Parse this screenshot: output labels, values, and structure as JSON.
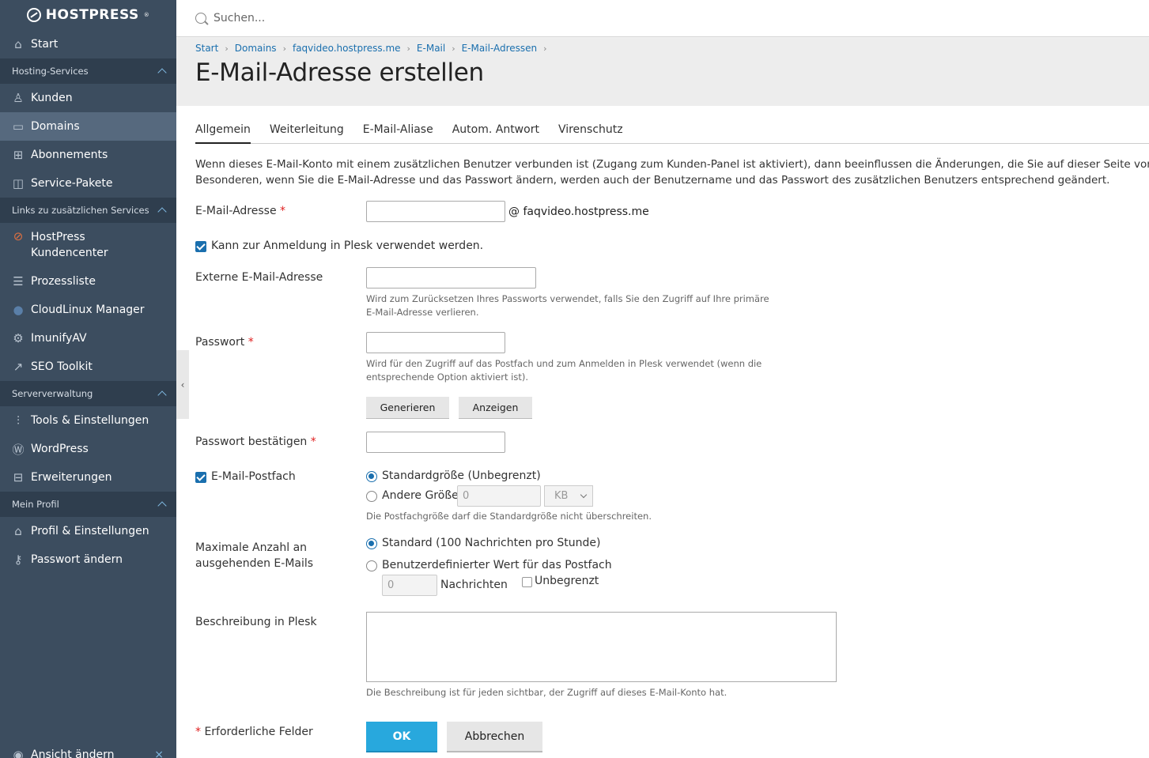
{
  "brand": {
    "name": "HOSTPRESS",
    "reg": "®"
  },
  "search": {
    "placeholder": "Suchen..."
  },
  "sidebar": {
    "start": "Start",
    "groups": {
      "hosting": "Hosting-Services",
      "links": "Links zu zusätzlichen Services",
      "server": "Serververwaltung",
      "profile": "Mein Profil"
    },
    "items": {
      "kunden": "Kunden",
      "domains": "Domains",
      "abonnements": "Abonnements",
      "service_pakete": "Service-Pakete",
      "hostpress_kc_1": "HostPress",
      "hostpress_kc_2": "Kundencenter",
      "prozessliste": "Prozessliste",
      "cloudlinux": "CloudLinux Manager",
      "imunify": "ImunifyAV",
      "seo": "SEO Toolkit",
      "tools": "Tools & Einstellungen",
      "wordpress": "WordPress",
      "erweiterungen": "Erweiterungen",
      "profil": "Profil & Einstellungen",
      "passwort": "Passwort ändern",
      "ansicht": "Ansicht ändern"
    }
  },
  "breadcrumb": [
    "Start",
    "Domains",
    "faqvideo.hostpress.me",
    "E-Mail",
    "E-Mail-Adressen"
  ],
  "page_title": "E-Mail-Adresse erstellen",
  "tabs": [
    "Allgemein",
    "Weiterleitung",
    "E-Mail-Aliase",
    "Autom. Antwort",
    "Virenschutz"
  ],
  "intro": {
    "line1": "Wenn dieses E-Mail-Konto mit einem zusätzlichen Benutzer verbunden ist (Zugang zum Kunden-Panel ist aktiviert), dann beeinflussen die Änderungen, die Sie auf dieser Seite vornehmen, a",
    "line2": "Besonderen, wenn Sie die E-Mail-Adresse und das Passwort ändern, werden auch der Benutzername und das Passwort des zusätzlichen Benutzers entsprechend geändert."
  },
  "form": {
    "email_label": "E-Mail-Adresse",
    "required_mark": "*",
    "email_domain": "@ faqvideo.hostpress.me",
    "login_checkbox": "Kann zur Anmeldung in Plesk verwendet werden.",
    "external_label": "Externe E-Mail-Adresse",
    "external_hint_1": "Wird zum Zurücksetzen Ihres Passworts verwendet, falls Sie den Zugriff auf Ihre primäre",
    "external_hint_2": "E-Mail-Adresse verlieren.",
    "password_label": "Passwort",
    "password_hint_1": "Wird für den Zugriff auf das Postfach und zum Anmelden in Plesk verwendet (wenn die",
    "password_hint_2": "entsprechende Option aktiviert ist).",
    "generate_btn": "Generieren",
    "show_btn": "Anzeigen",
    "confirm_label": "Passwort bestätigen",
    "mailbox_label": "E-Mail-Postfach",
    "size_default": "Standardgröße (Unbegrenzt)",
    "size_other": "Andere Größe",
    "size_value": "0",
    "size_unit": "KB",
    "size_hint": "Die Postfachgröße darf die Standardgröße nicht überschreiten.",
    "max_label_1": "Maximale Anzahl an",
    "max_label_2": "ausgehenden E-Mails",
    "max_default": "Standard (100 Nachrichten pro Stunde)",
    "max_custom": "Benutzerdefinierter Wert für das Postfach",
    "max_value": "0",
    "max_unit": "Nachrichten",
    "unlimited": "Unbegrenzt",
    "desc_label": "Beschreibung in Plesk",
    "desc_hint": "Die Beschreibung ist für jeden sichtbar, der Zugriff auf dieses E-Mail-Konto hat.",
    "required_note": "Erforderliche Felder",
    "ok_btn": "OK",
    "cancel_btn": "Abbrechen"
  },
  "colors": {
    "sidebar": "#3c4d5f",
    "accent": "#28a8dd",
    "link": "#1a6fae"
  }
}
